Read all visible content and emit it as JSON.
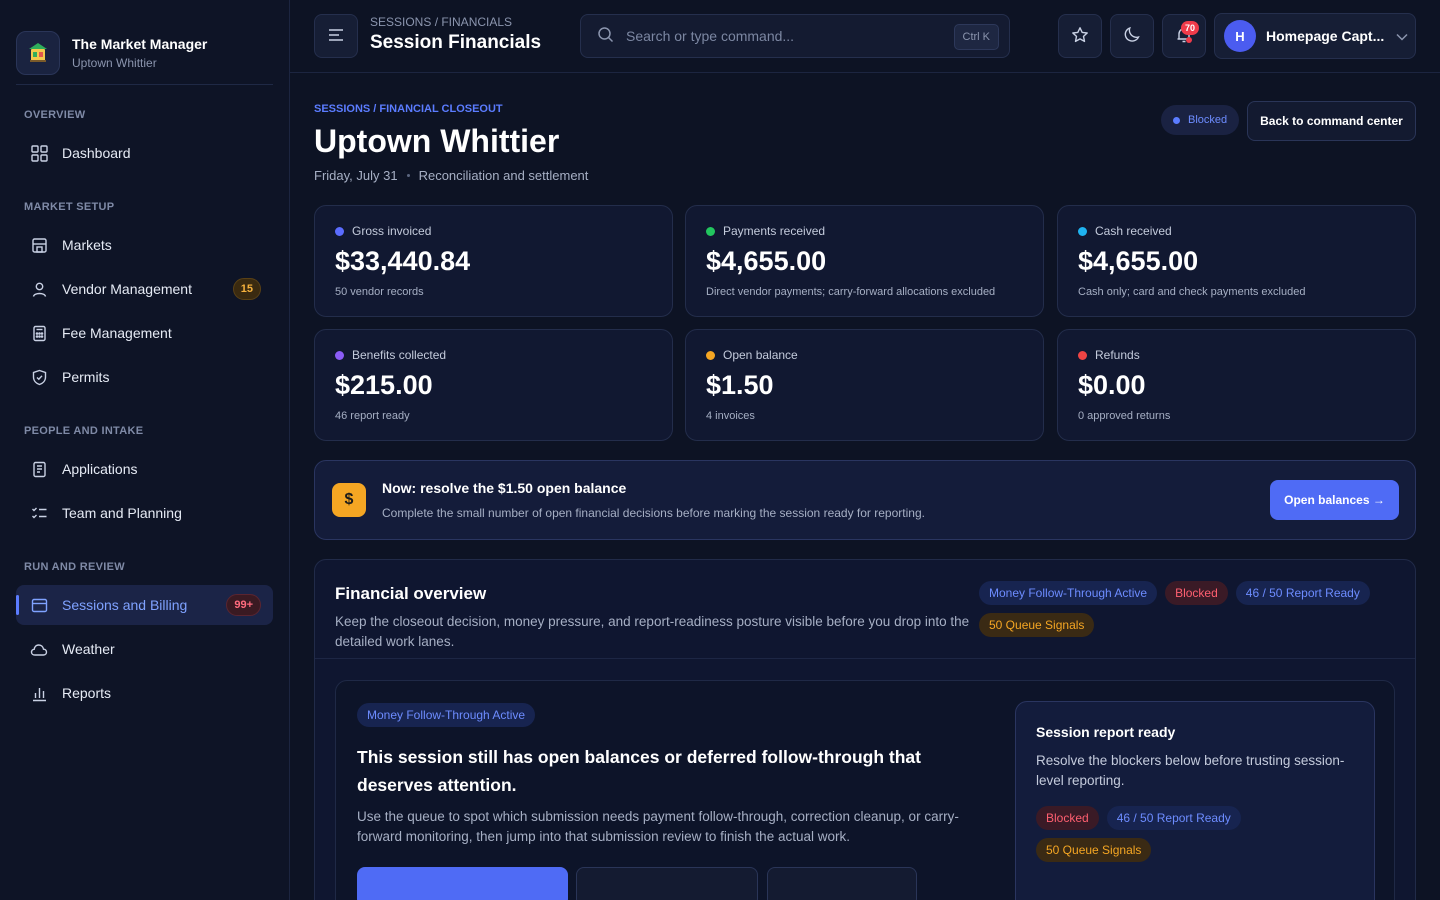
{
  "brand": {
    "title": "The Market Manager",
    "subtitle": "Uptown Whittier"
  },
  "sidebar": {
    "sections": [
      {
        "label": "OVERVIEW"
      },
      {
        "label": "MARKET SETUP"
      },
      {
        "label": "PEOPLE AND INTAKE"
      },
      {
        "label": "RUN AND REVIEW"
      }
    ],
    "items": [
      {
        "label": "Dashboard",
        "icon": "grid-icon"
      },
      {
        "label": "Markets",
        "icon": "store-icon"
      },
      {
        "label": "Vendor Management",
        "icon": "user-icon",
        "badge": "15"
      },
      {
        "label": "Fee Management",
        "icon": "calculator-icon"
      },
      {
        "label": "Permits",
        "icon": "shield-icon"
      },
      {
        "label": "Applications",
        "icon": "document-icon"
      },
      {
        "label": "Team and Planning",
        "icon": "checklist-icon"
      },
      {
        "label": "Sessions and Billing",
        "icon": "calendar-icon",
        "badge": "99+",
        "active": true
      },
      {
        "label": "Weather",
        "icon": "cloud-icon"
      },
      {
        "label": "Reports",
        "icon": "bar-chart-icon"
      }
    ]
  },
  "topbar": {
    "breadcrumb": "SESSIONS / FINANCIALS",
    "title": "Session Financials",
    "search_placeholder": "Search or type command...",
    "shortcut": "Ctrl K",
    "notification_count": "70",
    "user_initial": "H",
    "user_name": "Homepage Capt..."
  },
  "page": {
    "eyebrow": "SESSIONS / FINANCIAL CLOSEOUT",
    "title": "Uptown Whittier",
    "date": "Friday, July 31",
    "subtitle": "Reconciliation and settlement",
    "status": "Blocked",
    "back_button": "Back to command center"
  },
  "stats": [
    {
      "label": "Gross invoiced",
      "value": "$33,440.84",
      "note": "50 vendor records",
      "color": "#5b6cff"
    },
    {
      "label": "Payments received",
      "value": "$4,655.00",
      "note": "Direct vendor payments; carry-forward allocations excluded",
      "color": "#22c55e"
    },
    {
      "label": "Cash received",
      "value": "$4,655.00",
      "note": "Cash only; card and check payments excluded",
      "color": "#1fb3f0"
    },
    {
      "label": "Benefits collected",
      "value": "$215.00",
      "note": "46 report ready",
      "color": "#8b5cf6"
    },
    {
      "label": "Open balance",
      "value": "$1.50",
      "note": "4 invoices",
      "color": "#f5a623"
    },
    {
      "label": "Refunds",
      "value": "$0.00",
      "note": "0 approved returns",
      "color": "#ef4444"
    }
  ],
  "alert": {
    "icon": "$",
    "title": "Now: resolve the $1.50 open balance",
    "text": "Complete the small number of open financial decisions before marking the session ready for reporting.",
    "button": "Open balances →"
  },
  "overview": {
    "title": "Financial overview",
    "description": "Keep the closeout decision, money pressure, and report-readiness posture visible before you drop into the detailed work lanes.",
    "chips": [
      {
        "label": "Money Follow-Through Active",
        "tone": "blue"
      },
      {
        "label": "Blocked",
        "tone": "red"
      },
      {
        "label": "46 / 50 Report Ready",
        "tone": "blue"
      },
      {
        "label": "50 Queue Signals",
        "tone": "amber"
      }
    ],
    "focus_chip": "Money Follow-Through Active",
    "focus_title": "This session still has open balances or deferred follow-through that deserves attention.",
    "focus_text": "Use the queue to spot which submission needs payment follow-through, correction cleanup, or carry-forward monitoring, then jump into that submission review to finish the actual work.",
    "report": {
      "title": "Session report ready",
      "text": "Resolve the blockers below before trusting session-level reporting.",
      "chips": [
        {
          "label": "Blocked",
          "tone": "red"
        },
        {
          "label": "46 / 50 Report Ready",
          "tone": "blue"
        },
        {
          "label": "50 Queue Signals",
          "tone": "amber"
        }
      ]
    }
  }
}
